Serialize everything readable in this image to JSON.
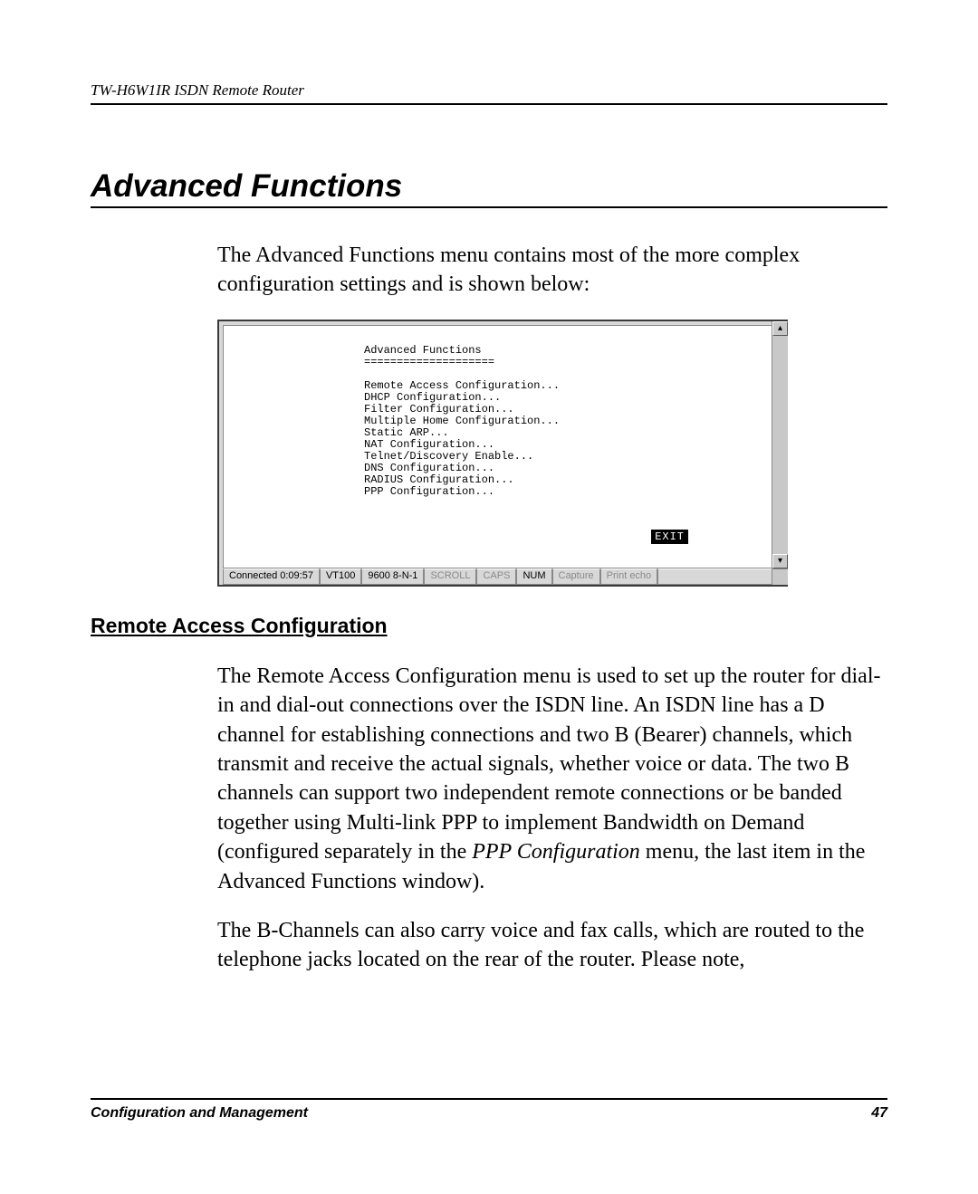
{
  "running_head": "TW-H6W1IR ISDN Remote Router",
  "section_title": "Advanced Functions",
  "intro_paragraph": "The Advanced Functions menu contains most of the more complex configuration settings and is shown below:",
  "terminal": {
    "title": "Advanced Functions",
    "underline": "====================",
    "menu_items": [
      "Remote Access Configuration...",
      "DHCP Configuration...",
      "Filter Configuration...",
      "Multiple Home Configuration...",
      "Static ARP...",
      "NAT Configuration...",
      "Telnet/Discovery Enable...",
      "DNS Configuration...",
      "RADIUS Configuration...",
      "PPP Configuration..."
    ],
    "exit_label": "EXIT",
    "scroll_up_glyph": "▴",
    "scroll_down_glyph": "▾",
    "status": {
      "connected": "Connected 0:09:57",
      "emulation": "VT100",
      "port": "9600 8-N-1",
      "scroll": "SCROLL",
      "caps": "CAPS",
      "num": "NUM",
      "capture": "Capture",
      "printecho": "Print echo"
    }
  },
  "subheading": "Remote Access Configuration",
  "para1_pre": "The Remote Access Configuration menu is used to set up the router for dial-in and dial-out connections over the ISDN line. An ISDN line has a D channel for establishing connections and two B (Bearer) channels, which transmit and receive the actual signals, whether voice or data. The two B channels can support two independent remote connections or be banded together using Multi-link PPP to implement Bandwidth on Demand (configured separately in the ",
  "para1_ital": "PPP Configuration",
  "para1_post": " menu, the last item in the Advanced Functions window).",
  "para2": "The B-Channels can also carry voice and fax calls, which are routed to the telephone jacks located on the rear of the router. Please note,",
  "footer_left": "Configuration and Management",
  "footer_right": "47"
}
